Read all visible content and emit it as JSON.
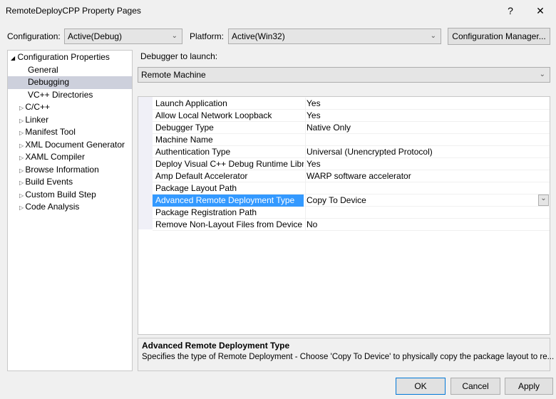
{
  "window": {
    "title": "RemoteDeployCPP Property Pages",
    "help": "?",
    "close": "✕"
  },
  "config": {
    "label": "Configuration:",
    "value": "Active(Debug)",
    "platform_label": "Platform:",
    "platform_value": "Active(Win32)",
    "manager_button": "Configuration Manager..."
  },
  "tree": {
    "root": "Configuration Properties",
    "items": [
      {
        "label": "General",
        "expandable": false
      },
      {
        "label": "Debugging",
        "expandable": false,
        "selected": true
      },
      {
        "label": "VC++ Directories",
        "expandable": false
      },
      {
        "label": "C/C++",
        "expandable": true
      },
      {
        "label": "Linker",
        "expandable": true
      },
      {
        "label": "Manifest Tool",
        "expandable": true
      },
      {
        "label": "XML Document Generator",
        "expandable": true
      },
      {
        "label": "XAML Compiler",
        "expandable": true
      },
      {
        "label": "Browse Information",
        "expandable": true
      },
      {
        "label": "Build Events",
        "expandable": true
      },
      {
        "label": "Custom Build Step",
        "expandable": true
      },
      {
        "label": "Code Analysis",
        "expandable": true
      }
    ]
  },
  "debugger": {
    "label": "Debugger to launch:",
    "value": "Remote Machine"
  },
  "properties": [
    {
      "name": "Launch Application",
      "value": "Yes"
    },
    {
      "name": "Allow Local Network Loopback",
      "value": "Yes"
    },
    {
      "name": "Debugger Type",
      "value": "Native Only"
    },
    {
      "name": "Machine Name",
      "value": ""
    },
    {
      "name": "Authentication Type",
      "value": "Universal (Unencrypted Protocol)"
    },
    {
      "name": "Deploy Visual C++ Debug Runtime Libraries",
      "value": "Yes"
    },
    {
      "name": "Amp Default Accelerator",
      "value": "WARP software accelerator"
    },
    {
      "name": "Package Layout Path",
      "value": ""
    },
    {
      "name": "Advanced Remote Deployment Type",
      "value": "Copy To Device",
      "selected": true
    },
    {
      "name": "Package Registration Path",
      "value": ""
    },
    {
      "name": "Remove Non-Layout Files from Device",
      "value": "No"
    }
  ],
  "description": {
    "title": "Advanced Remote Deployment Type",
    "text": "Specifies the type of Remote Deployment - Choose 'Copy To Device' to physically copy the package layout to re..."
  },
  "buttons": {
    "ok": "OK",
    "cancel": "Cancel",
    "apply": "Apply"
  },
  "colors": {
    "selection": "#3399ff",
    "tree_selection": "#cdd0dc"
  }
}
